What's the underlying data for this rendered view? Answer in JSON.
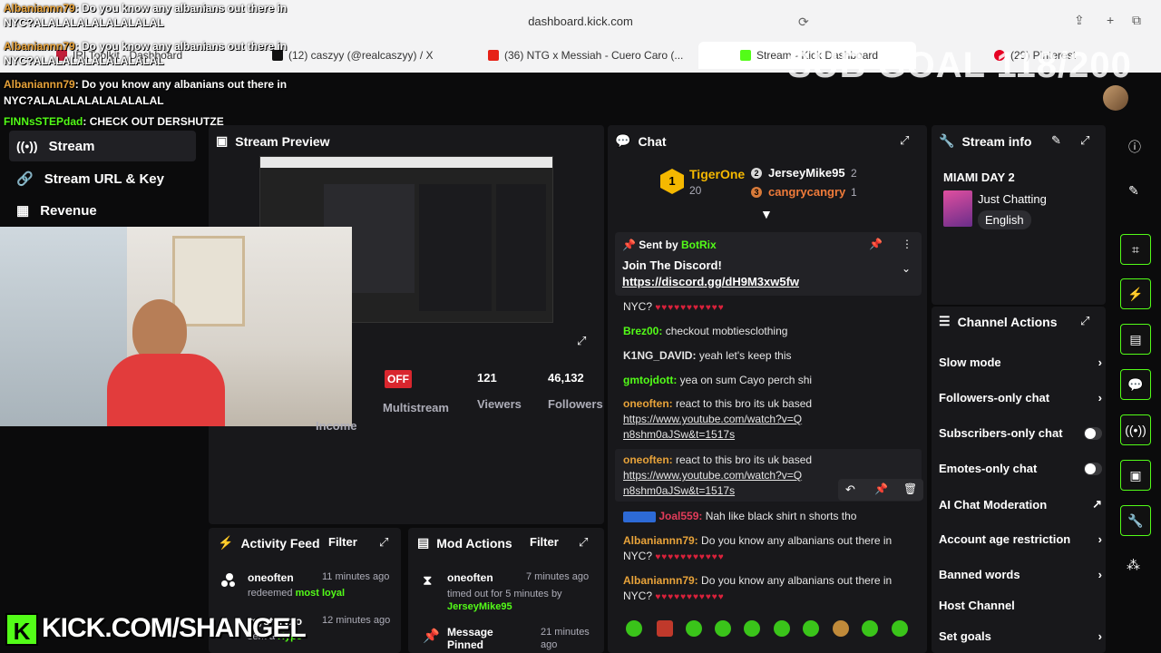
{
  "browser": {
    "url": "dashboard.kick.com",
    "tabs": [
      {
        "label": "IRLToolkit - Dashboard"
      },
      {
        "label": "(12) caszyy (@realcaszyy) / X"
      },
      {
        "label": "(36) NTG x Messiah - Cuero Caro (..."
      },
      {
        "label": "Stream - Kick Dashboard"
      },
      {
        "label": "(29) Pinterest"
      }
    ]
  },
  "overlay_chat": [
    {
      "user": "Albaniannn79",
      "text": ": Do you know any albanians out there in",
      "line2": "NYC?ALALALALALALALALAL"
    },
    {
      "user": "Albaniannn79",
      "text": ": Do you know any albanians out there in",
      "line2": "NYC?ALALALALALALALALAL"
    },
    {
      "user": "Albaniannn79",
      "text": ": Do you know any albanians out there in",
      "line2": "NYC?ALALALALALALALALAL"
    },
    {
      "user": "FINNsSTEPdad",
      "text": ": CHECK OUT DERSHUTZE"
    }
  ],
  "sub_goal": "SUB GOAL 118/200",
  "nav": {
    "stream": "Stream",
    "url_key": "Stream URL & Key",
    "revenue": "Revenue"
  },
  "preview": {
    "title": "Stream Preview",
    "status": "OFF",
    "multistream": "Multistream",
    "viewers_value": "121",
    "viewers_label": "Viewers",
    "followers_value": "46,132",
    "followers_label": "Followers",
    "income_label": "Income"
  },
  "activity": {
    "title": "Activity Feed",
    "filter": "Filter",
    "items": [
      {
        "user": "oneoften",
        "time": "11 minutes ago",
        "action": "redeemed",
        "reward": "most loyal"
      },
      {
        "user": "mysteryxo",
        "time": "12 minutes ago",
        "action": "sent a",
        "reward": "Hype"
      }
    ]
  },
  "mod": {
    "title": "Mod Actions",
    "filter": "Filter",
    "items": [
      {
        "user": "oneoften",
        "time": "7 minutes ago",
        "detail": "timed out for 5 minutes by",
        "by": "JerseyMike95"
      },
      {
        "user": "Message Pinned",
        "time": "21 minutes ago"
      }
    ]
  },
  "chat": {
    "title": "Chat",
    "leaders": {
      "top_name": "TigerOne",
      "top_count": "20",
      "second_name": "JerseyMike95",
      "second_count": "2",
      "third_name": "cangrycangry",
      "third_count": "1"
    },
    "pinned": {
      "sent_by_label": "Sent by",
      "sender": "BotRix",
      "title": "Join The Discord!",
      "link": "https://discord.gg/dH9M3xw5fw"
    },
    "messages": [
      {
        "user": "",
        "text": "NYC?"
      },
      {
        "user": "Brez00:",
        "text": "checkout mobtiesclothing"
      },
      {
        "user": "K1NG_DAVID:",
        "text": "yeah let's keep this"
      },
      {
        "user": "gmtojdott:",
        "text": "yea on sum Cayo perch shi"
      },
      {
        "user": "oneoften:",
        "text": "react to this bro its uk based",
        "link": "https://www.youtube.com/watch?v=Qn8shm0aJSw&t=1517s"
      },
      {
        "user": "oneoften:",
        "text": "react to this bro its uk based",
        "link": "https://www.youtube.com/watch?v=Qn8shm0aJSw&t=1517s"
      },
      {
        "user": "Joal559:",
        "text": "Nah like black shirt n shorts tho"
      },
      {
        "user": "Albaniannn79:",
        "text": "Do you know any albanians out there in",
        "line2": "NYC?"
      },
      {
        "user": "Albaniannn79:",
        "text": "Do you know any albanians out there in",
        "line2": "NYC?"
      }
    ]
  },
  "stream_info": {
    "title": "Stream info",
    "stream_title": "MIAMI DAY 2",
    "category": "Just Chatting",
    "language": "English"
  },
  "channel_actions": {
    "title": "Channel Actions",
    "items": [
      {
        "label": "Slow mode"
      },
      {
        "label": "Followers-only chat"
      },
      {
        "label": "Subscribers-only chat"
      },
      {
        "label": "Emotes-only chat"
      },
      {
        "label": "AI Chat Moderation"
      },
      {
        "label": "Account age restriction"
      },
      {
        "label": "Banned words"
      },
      {
        "label": "Host Channel"
      },
      {
        "label": "Set goals"
      }
    ]
  },
  "branding": "KICK.COM/SHANGEL",
  "colors": {
    "accent": "#53fc18",
    "panel": "#18181b",
    "background": "#0b0b0c"
  }
}
